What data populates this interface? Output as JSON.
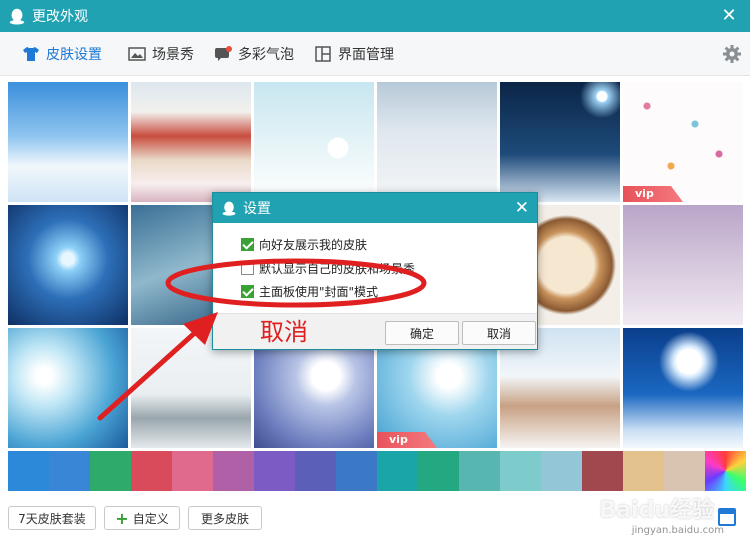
{
  "window": {
    "title": "更改外观",
    "close_glyph": "✕"
  },
  "tabs": [
    {
      "label": "皮肤设置",
      "icon": "shirt-icon",
      "active": true
    },
    {
      "label": "场景秀",
      "icon": "picture-icon",
      "active": false
    },
    {
      "label": "多彩气泡",
      "icon": "bubble-icon",
      "active": false
    },
    {
      "label": "界面管理",
      "icon": "layout-icon",
      "active": false
    }
  ],
  "settings_icon": "gear-icon",
  "skins": [
    {
      "name": "sky-clouds",
      "vip": false
    },
    {
      "name": "snowy-street",
      "vip": false
    },
    {
      "name": "snowman",
      "vip": false
    },
    {
      "name": "snowy-trees",
      "vip": false
    },
    {
      "name": "night-lamp-snow",
      "vip": false
    },
    {
      "name": "flower-pattern",
      "vip": true
    },
    {
      "name": "snowflake",
      "vip": false
    },
    {
      "name": "merry-christmas",
      "vip": false
    },
    {
      "name": "hidden-1",
      "vip": false
    },
    {
      "name": "hidden-2",
      "vip": false
    },
    {
      "name": "latte-snowflake",
      "vip": false
    },
    {
      "name": "purple-trees",
      "vip": false
    },
    {
      "name": "blue-branch",
      "vip": false
    },
    {
      "name": "winter-lake",
      "vip": false
    },
    {
      "name": "bird-berries",
      "vip": false
    },
    {
      "name": "feather",
      "vip": true
    },
    {
      "name": "snow-fence",
      "vip": false
    },
    {
      "name": "moon-reindeer",
      "vip": false
    }
  ],
  "vip_label": "vip",
  "swatches": [
    "#2c88d8",
    "#3a86d6",
    "#2eaa6a",
    "#d94a5a",
    "#e06a8e",
    "#b060a6",
    "#7c5cc4",
    "#5b5fb8",
    "#3b79c6",
    "#1aa6a8",
    "#23a882",
    "#57b6b0",
    "#7ecbcb",
    "#93c7d8",
    "#a0484e",
    "#e3c28e",
    "#d8c4b0",
    "#rainbow"
  ],
  "buttons": {
    "suit": "7天皮肤套装",
    "custom": "自定义",
    "more": "更多皮肤"
  },
  "dialog": {
    "title": "设置",
    "options": [
      {
        "label": "向好友展示我的皮肤",
        "checked": true
      },
      {
        "label": "默认显示自己的皮肤和场景秀",
        "checked": false
      },
      {
        "label": "主面板使用\"封面\"模式",
        "checked": true
      }
    ],
    "ok": "确定",
    "cancel": "取消"
  },
  "annotation": {
    "text": "取消",
    "color": "#e02020"
  },
  "watermark": {
    "text": "Baidu经验",
    "sub": "jingyan.baidu.com"
  }
}
